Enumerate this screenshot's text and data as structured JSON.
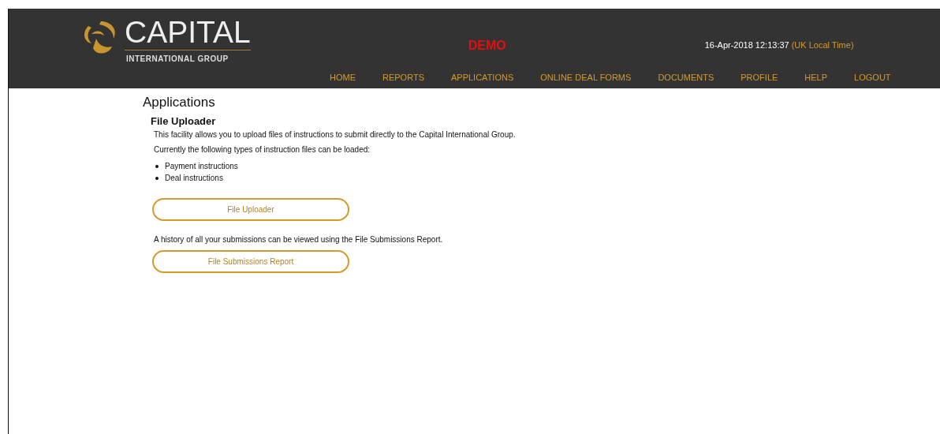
{
  "header": {
    "logo": {
      "name": "CAPITAL",
      "subtitle": "INTERNATIONAL GROUP"
    },
    "environment": "DEMO",
    "datetime": "16-Apr-2018 12:13:37",
    "timezone_note": "(UK Local Time)",
    "nav": [
      "HOME",
      "REPORTS",
      "APPLICATIONS",
      "ONLINE DEAL FORMS",
      "DOCUMENTS",
      "PROFILE",
      "HELP",
      "LOGOUT"
    ]
  },
  "page": {
    "title": "Applications",
    "section_title": "File Uploader",
    "intro": "This facility allows you to upload files of instructions to submit directly to the Capital International Group.",
    "types_label": "Currently the following types of instruction files can be loaded:",
    "types": [
      "Payment instructions",
      "Deal instructions"
    ],
    "upload_button": "File Uploader",
    "history_text": "A history of all your submissions can be viewed using the File Submissions Report.",
    "report_button": "File Submissions Report"
  }
}
